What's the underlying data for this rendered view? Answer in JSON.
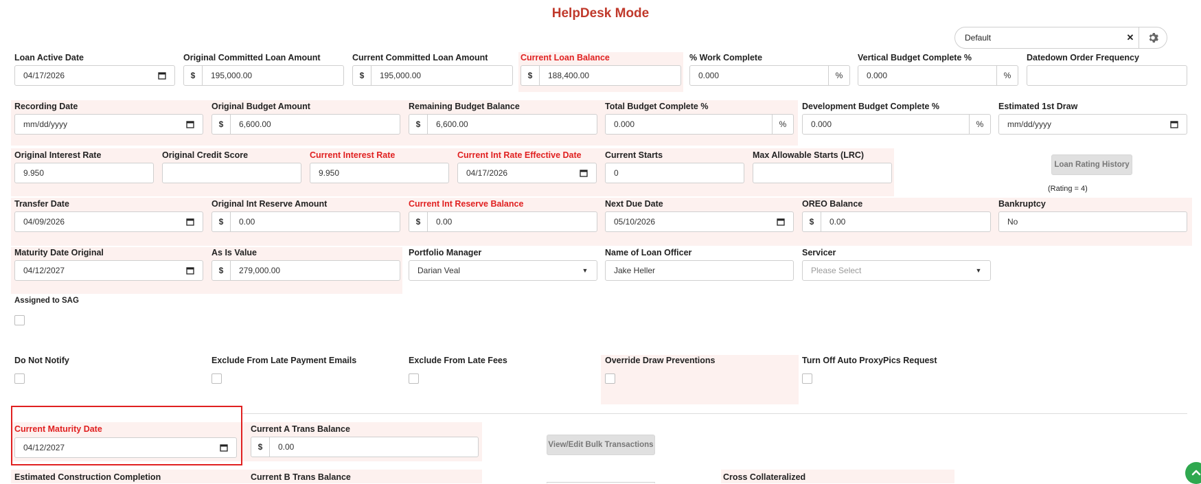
{
  "header": {
    "title": "HelpDesk Mode"
  },
  "profile_select": {
    "value": "Default"
  },
  "fields": {
    "loan_active_date": {
      "label": "Loan Active Date",
      "value": "04/17/2026"
    },
    "original_committed_loan_amount": {
      "label": "Original Committed Loan Amount",
      "prefix": "$",
      "value": "195,000.00"
    },
    "current_committed_loan_amount": {
      "label": "Current Committed Loan Amount",
      "prefix": "$",
      "value": "195,000.00"
    },
    "current_loan_balance": {
      "label": "Current Loan Balance",
      "prefix": "$",
      "value": "188,400.00"
    },
    "work_complete": {
      "label": "% Work Complete",
      "value": "0.000",
      "suffix": "%"
    },
    "vertical_budget_complete": {
      "label": "Vertical Budget Complete %",
      "value": "0.000",
      "suffix": "%"
    },
    "datedown_order_frequency": {
      "label": "Datedown Order Frequency",
      "value": ""
    },
    "recording_date": {
      "label": "Recording Date",
      "placeholder": "mm/dd/yyyy"
    },
    "original_budget_amount": {
      "label": "Original Budget Amount",
      "prefix": "$",
      "value": "6,600.00"
    },
    "remaining_budget_balance": {
      "label": "Remaining Budget Balance",
      "prefix": "$",
      "value": "6,600.00"
    },
    "total_budget_complete": {
      "label": "Total Budget Complete %",
      "value": "0.000",
      "suffix": "%"
    },
    "development_budget_complete": {
      "label": "Development Budget Complete %",
      "value": "0.000",
      "suffix": "%"
    },
    "estimated_first_draw": {
      "label": "Estimated 1st Draw",
      "placeholder": "mm/dd/yyyy"
    },
    "original_interest_rate": {
      "label": "Original Interest Rate",
      "value": "9.950"
    },
    "original_credit_score": {
      "label": "Original Credit Score",
      "value": ""
    },
    "current_interest_rate": {
      "label": "Current Interest Rate",
      "value": "9.950"
    },
    "current_int_rate_effective_date": {
      "label": "Current Int Rate Effective Date",
      "value": "04/17/2026"
    },
    "current_starts": {
      "label": "Current Starts",
      "value": "0"
    },
    "max_allowable_starts": {
      "label": "Max Allowable Starts (LRC)",
      "value": ""
    },
    "loan_rating_history": {
      "button": "Loan Rating History",
      "note": "(Rating = 4)"
    },
    "transfer_date": {
      "label": "Transfer Date",
      "value": "04/09/2026"
    },
    "original_int_reserve_amount": {
      "label": "Original Int Reserve Amount",
      "prefix": "$",
      "value": "0.00"
    },
    "current_int_reserve_balance": {
      "label": "Current Int Reserve Balance",
      "prefix": "$",
      "value": "0.00"
    },
    "next_due_date": {
      "label": "Next Due Date",
      "value": "05/10/2026"
    },
    "oreo_balance": {
      "label": "OREO Balance",
      "prefix": "$",
      "value": "0.00"
    },
    "bankruptcy": {
      "label": "Bankruptcy",
      "value": "No"
    },
    "maturity_date_original": {
      "label": "Maturity Date Original",
      "value": "04/12/2027"
    },
    "as_is_value": {
      "label": "As Is Value",
      "prefix": "$",
      "value": "279,000.00"
    },
    "portfolio_manager": {
      "label": "Portfolio Manager",
      "value": "Darian Veal"
    },
    "name_of_loan_officer": {
      "label": "Name of Loan Officer",
      "value": "Jake Heller"
    },
    "servicer": {
      "label": "Servicer",
      "placeholder": "Please Select"
    },
    "assigned_to_sag": {
      "label": "Assigned to SAG"
    },
    "do_not_notify": {
      "label": "Do Not Notify"
    },
    "exclude_late_payment_emails": {
      "label": "Exclude From Late Payment Emails"
    },
    "exclude_late_fees": {
      "label": "Exclude From Late Fees"
    },
    "override_draw_preventions": {
      "label": "Override Draw Preventions"
    },
    "turn_off_auto_proxypics": {
      "label": "Turn Off Auto ProxyPics Request"
    },
    "current_maturity_date": {
      "label": "Current Maturity Date",
      "value": "04/12/2027"
    },
    "current_a_trans_balance": {
      "label": "Current A Trans Balance",
      "prefix": "$",
      "value": "0.00"
    },
    "view_edit_bulk_transactions": {
      "button": "View/Edit Bulk Transactions"
    },
    "estimated_construction_completion": {
      "label": "Estimated Construction Completion"
    },
    "current_b_trans_balance": {
      "label": "Current B Trans Balance"
    },
    "cross_collateralized": {
      "label": "Cross Collateralized"
    }
  },
  "colors": {
    "accent_red": "#e02020",
    "title_red": "#c0392b",
    "highlight_bg": "#fdf1ef",
    "scroll_green": "#2fa84f"
  }
}
